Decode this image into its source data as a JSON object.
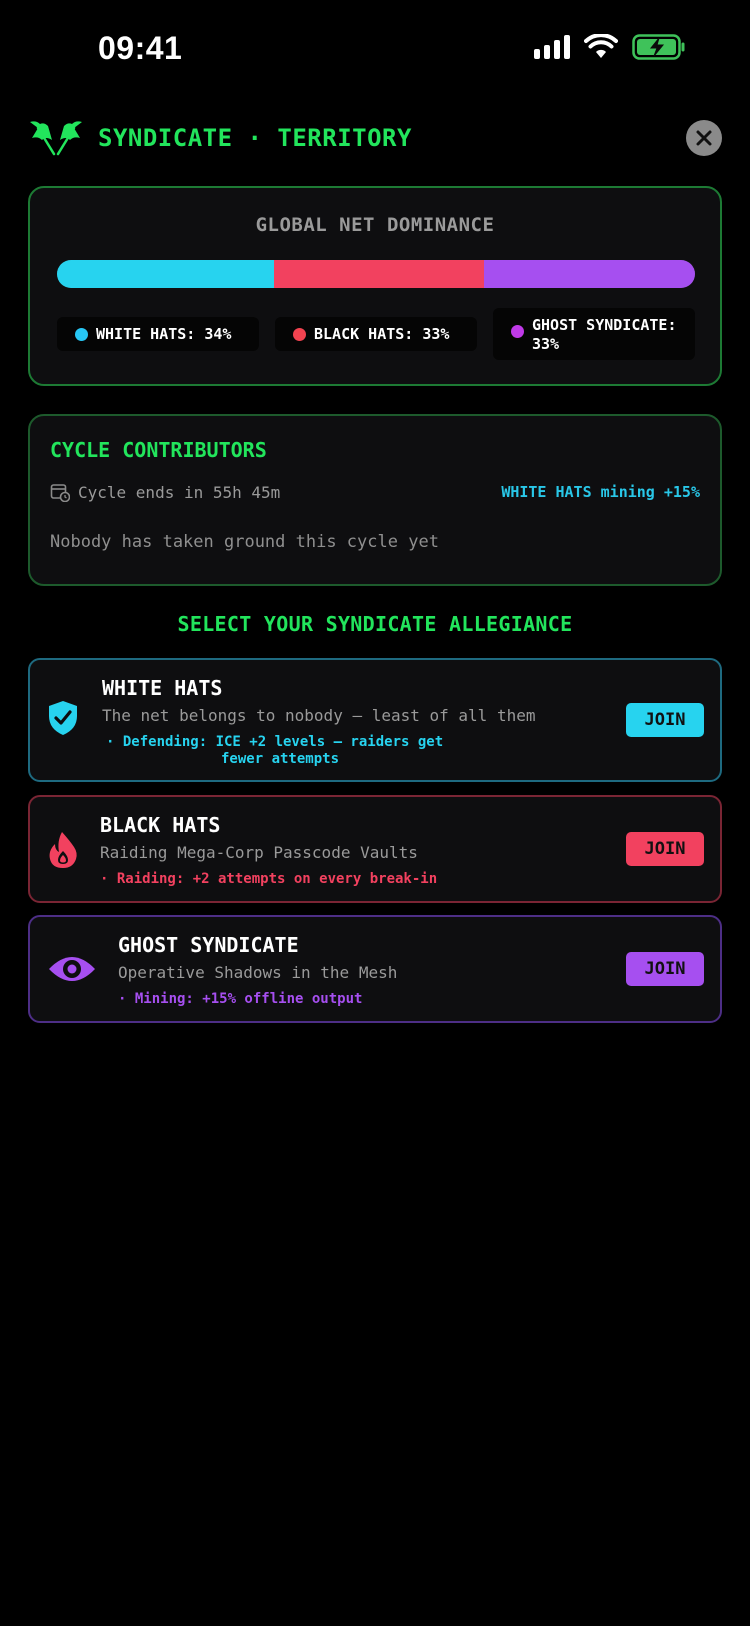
{
  "status_bar": {
    "time": "09:41"
  },
  "header": {
    "title": "SYNDICATE · TERRITORY"
  },
  "dominance": {
    "title": "GLOBAL NET DOMINANCE",
    "segments": [
      {
        "label": "WHITE HATS: 34%",
        "percent": 34,
        "color": "#27d3ef"
      },
      {
        "label": "BLACK HATS: 33%",
        "percent": 33,
        "color": "#f2415f"
      },
      {
        "label": "GHOST SYNDICATE: 33%",
        "percent": 33,
        "color": "#a64ff0"
      }
    ],
    "legend_dot_colors": [
      "#27c7f5",
      "#f24350",
      "#c03ae8"
    ]
  },
  "contributors": {
    "title": "CYCLE CONTRIBUTORS",
    "cycle_text": "Cycle ends in 55h 45m",
    "bonus_text": "WHITE HATS mining +15%",
    "empty_text": "Nobody has taken ground this cycle yet"
  },
  "allegiance": {
    "title": "SELECT YOUR SYNDICATE ALLEGIANCE",
    "factions": [
      {
        "name": "WHITE HATS",
        "description": "The net belongs to nobody — least of all them",
        "perk_line1": "· Defending: ICE +2 levels — raiders get",
        "perk_line2": "fewer attempts",
        "join_label": "JOIN",
        "icon": "shield-check-icon",
        "color": "#27d3ef"
      },
      {
        "name": "BLACK HATS",
        "description": "Raiding Mega-Corp Passcode Vaults",
        "perk_line1": "· Raiding: +2 attempts on every break-in",
        "join_label": "JOIN",
        "icon": "flame-icon",
        "color": "#f2415f"
      },
      {
        "name": "GHOST SYNDICATE",
        "description": "Operative Shadows in the Mesh",
        "perk_line1": "· Mining: +15% offline output",
        "join_label": "JOIN",
        "icon": "eye-icon",
        "color": "#a64ff0"
      }
    ]
  }
}
